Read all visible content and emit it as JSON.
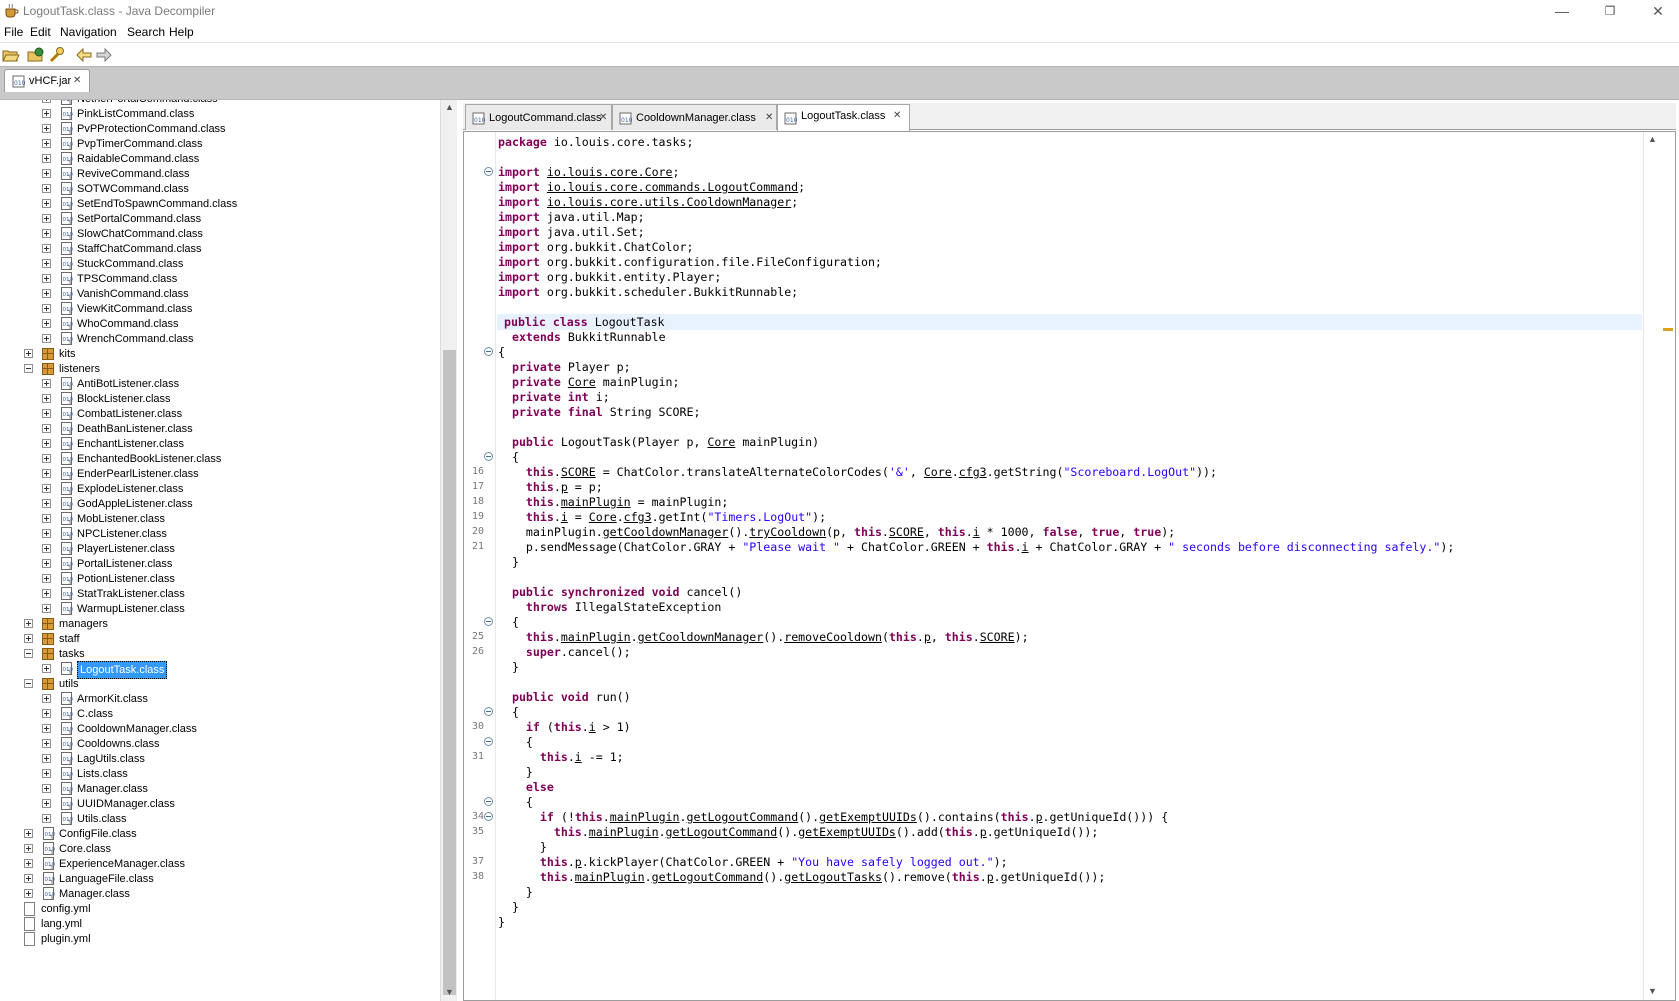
{
  "window": {
    "title": "LogoutTask.class - Java Decompiler",
    "minimize": "—",
    "restore": "❐",
    "close": "✕"
  },
  "menu": [
    "File",
    "Edit",
    "Navigation",
    "Search",
    "Help"
  ],
  "jar_tab": {
    "label": "vHCF.jar",
    "close": "✕"
  },
  "tree": [
    {
      "label": "NetherPortalCommand.class",
      "indent": 2,
      "kind": "class",
      "exp": "plus"
    },
    {
      "label": "PinkListCommand.class",
      "indent": 2,
      "kind": "class",
      "exp": "plus"
    },
    {
      "label": "PvPProtectionCommand.class",
      "indent": 2,
      "kind": "class",
      "exp": "plus"
    },
    {
      "label": "PvpTimerCommand.class",
      "indent": 2,
      "kind": "class",
      "exp": "plus"
    },
    {
      "label": "RaidableCommand.class",
      "indent": 2,
      "kind": "class",
      "exp": "plus"
    },
    {
      "label": "ReviveCommand.class",
      "indent": 2,
      "kind": "class",
      "exp": "plus"
    },
    {
      "label": "SOTWCommand.class",
      "indent": 2,
      "kind": "class",
      "exp": "plus"
    },
    {
      "label": "SetEndToSpawnCommand.class",
      "indent": 2,
      "kind": "class",
      "exp": "plus"
    },
    {
      "label": "SetPortalCommand.class",
      "indent": 2,
      "kind": "class",
      "exp": "plus"
    },
    {
      "label": "SlowChatCommand.class",
      "indent": 2,
      "kind": "class",
      "exp": "plus"
    },
    {
      "label": "StaffChatCommand.class",
      "indent": 2,
      "kind": "class",
      "exp": "plus"
    },
    {
      "label": "StuckCommand.class",
      "indent": 2,
      "kind": "class",
      "exp": "plus"
    },
    {
      "label": "TPSCommand.class",
      "indent": 2,
      "kind": "class",
      "exp": "plus"
    },
    {
      "label": "VanishCommand.class",
      "indent": 2,
      "kind": "class",
      "exp": "plus"
    },
    {
      "label": "ViewKitCommand.class",
      "indent": 2,
      "kind": "class",
      "exp": "plus"
    },
    {
      "label": "WhoCommand.class",
      "indent": 2,
      "kind": "class",
      "exp": "plus"
    },
    {
      "label": "WrenchCommand.class",
      "indent": 2,
      "kind": "class",
      "exp": "plus"
    },
    {
      "label": "kits",
      "indent": 1,
      "kind": "package",
      "exp": "plus"
    },
    {
      "label": "listeners",
      "indent": 1,
      "kind": "package",
      "exp": "minus"
    },
    {
      "label": "AntiBotListener.class",
      "indent": 2,
      "kind": "class",
      "exp": "plus"
    },
    {
      "label": "BlockListener.class",
      "indent": 2,
      "kind": "class",
      "exp": "plus"
    },
    {
      "label": "CombatListener.class",
      "indent": 2,
      "kind": "class",
      "exp": "plus"
    },
    {
      "label": "DeathBanListener.class",
      "indent": 2,
      "kind": "class",
      "exp": "plus"
    },
    {
      "label": "EnchantListener.class",
      "indent": 2,
      "kind": "class",
      "exp": "plus"
    },
    {
      "label": "EnchantedBookListener.class",
      "indent": 2,
      "kind": "class",
      "exp": "plus"
    },
    {
      "label": "EnderPearlListener.class",
      "indent": 2,
      "kind": "class",
      "exp": "plus"
    },
    {
      "label": "ExplodeListener.class",
      "indent": 2,
      "kind": "class",
      "exp": "plus"
    },
    {
      "label": "GodAppleListener.class",
      "indent": 2,
      "kind": "class",
      "exp": "plus"
    },
    {
      "label": "MobListener.class",
      "indent": 2,
      "kind": "class",
      "exp": "plus"
    },
    {
      "label": "NPCListener.class",
      "indent": 2,
      "kind": "class",
      "exp": "plus"
    },
    {
      "label": "PlayerListener.class",
      "indent": 2,
      "kind": "class",
      "exp": "plus"
    },
    {
      "label": "PortalListener.class",
      "indent": 2,
      "kind": "class",
      "exp": "plus"
    },
    {
      "label": "PotionListener.class",
      "indent": 2,
      "kind": "class",
      "exp": "plus"
    },
    {
      "label": "StatTrakListener.class",
      "indent": 2,
      "kind": "class",
      "exp": "plus"
    },
    {
      "label": "WarmupListener.class",
      "indent": 2,
      "kind": "class",
      "exp": "plus"
    },
    {
      "label": "managers",
      "indent": 1,
      "kind": "package",
      "exp": "plus"
    },
    {
      "label": "staff",
      "indent": 1,
      "kind": "package",
      "exp": "plus"
    },
    {
      "label": "tasks",
      "indent": 1,
      "kind": "package",
      "exp": "minus"
    },
    {
      "label": "LogoutTask.class",
      "indent": 2,
      "kind": "class",
      "exp": "plus",
      "selected": true
    },
    {
      "label": "utils",
      "indent": 1,
      "kind": "package",
      "exp": "minus"
    },
    {
      "label": "ArmorKit.class",
      "indent": 2,
      "kind": "class",
      "exp": "plus"
    },
    {
      "label": "C.class",
      "indent": 2,
      "kind": "class",
      "exp": "plus"
    },
    {
      "label": "CooldownManager.class",
      "indent": 2,
      "kind": "class",
      "exp": "plus"
    },
    {
      "label": "Cooldowns.class",
      "indent": 2,
      "kind": "class",
      "exp": "plus"
    },
    {
      "label": "LagUtils.class",
      "indent": 2,
      "kind": "class",
      "exp": "plus"
    },
    {
      "label": "Lists.class",
      "indent": 2,
      "kind": "class",
      "exp": "plus"
    },
    {
      "label": "Manager.class",
      "indent": 2,
      "kind": "class",
      "exp": "plus"
    },
    {
      "label": "UUIDManager.class",
      "indent": 2,
      "kind": "class",
      "exp": "plus"
    },
    {
      "label": "Utils.class",
      "indent": 2,
      "kind": "class",
      "exp": "plus"
    },
    {
      "label": "ConfigFile.class",
      "indent": 1,
      "kind": "class",
      "exp": "plus"
    },
    {
      "label": "Core.class",
      "indent": 1,
      "kind": "class",
      "exp": "plus"
    },
    {
      "label": "ExperienceManager.class",
      "indent": 1,
      "kind": "class",
      "exp": "plus"
    },
    {
      "label": "LanguageFile.class",
      "indent": 1,
      "kind": "class",
      "exp": "plus"
    },
    {
      "label": "Manager.class",
      "indent": 1,
      "kind": "class",
      "exp": "plus"
    },
    {
      "label": "config.yml",
      "indent": 0,
      "kind": "file"
    },
    {
      "label": "lang.yml",
      "indent": 0,
      "kind": "file"
    },
    {
      "label": "plugin.yml",
      "indent": 0,
      "kind": "file"
    }
  ],
  "editor_tabs": [
    {
      "label": "LogoutCommand.class",
      "close": "✕",
      "active": false
    },
    {
      "label": "CooldownManager.class",
      "close": "✕",
      "active": false
    },
    {
      "label": "LogoutTask.class",
      "close": "✕",
      "active": true
    }
  ],
  "code": [
    {
      "line": "",
      "fold": false,
      "html": "<span class=\"kw\">package</span> io.louis.core.tasks;"
    },
    {
      "line": "",
      "fold": false,
      "html": ""
    },
    {
      "line": "",
      "fold": true,
      "html": "<span class=\"kw\">import</span> <span class=\"u\">io.louis.core.Core</span>;"
    },
    {
      "line": "",
      "fold": false,
      "html": "<span class=\"kw\">import</span> <span class=\"u\">io.louis.core.commands.LogoutCommand</span>;"
    },
    {
      "line": "",
      "fold": false,
      "html": "<span class=\"kw\">import</span> <span class=\"u\">io.louis.core.utils.CooldownManager</span>;"
    },
    {
      "line": "",
      "fold": false,
      "html": "<span class=\"kw\">import</span> java.util.Map;"
    },
    {
      "line": "",
      "fold": false,
      "html": "<span class=\"kw\">import</span> java.util.Set;"
    },
    {
      "line": "",
      "fold": false,
      "html": "<span class=\"kw\">import</span> org.bukkit.ChatColor;"
    },
    {
      "line": "",
      "fold": false,
      "html": "<span class=\"kw\">import</span> org.bukkit.configuration.file.FileConfiguration;"
    },
    {
      "line": "",
      "fold": false,
      "html": "<span class=\"kw\">import</span> org.bukkit.entity.Player;"
    },
    {
      "line": "",
      "fold": false,
      "html": "<span class=\"kw\">import</span> org.bukkit.scheduler.BukkitRunnable;"
    },
    {
      "line": "",
      "fold": false,
      "html": ""
    },
    {
      "line": "",
      "fold": false,
      "hl": true,
      "html": "<span class=\"kw\">public class</span> LogoutTask"
    },
    {
      "line": "",
      "fold": false,
      "html": "  <span class=\"kw\">extends</span> BukkitRunnable"
    },
    {
      "line": "",
      "fold": true,
      "html": "{"
    },
    {
      "line": "",
      "fold": false,
      "html": "  <span class=\"kw\">private</span> Player p;"
    },
    {
      "line": "",
      "fold": false,
      "html": "  <span class=\"kw\">private</span> <span class=\"u\">Core</span> mainPlugin;"
    },
    {
      "line": "",
      "fold": false,
      "html": "  <span class=\"kw\">private int</span> i;"
    },
    {
      "line": "",
      "fold": false,
      "html": "  <span class=\"kw\">private final</span> String SCORE;"
    },
    {
      "line": "",
      "fold": false,
      "html": ""
    },
    {
      "line": "",
      "fold": false,
      "html": "  <span class=\"kw\">public</span> LogoutTask(Player p, <span class=\"u\">Core</span> mainPlugin)"
    },
    {
      "line": "",
      "fold": true,
      "html": "  {"
    },
    {
      "line": "16",
      "fold": false,
      "html": "    <span class=\"kw\">this</span>.<span class=\"u\">SCORE</span> = ChatColor.translateAlternateColorCodes(<span class=\"str\">'&amp;'</span>, <span class=\"u\">Core</span>.<span class=\"u\">cfg3</span>.getString(<span class=\"str\">\"Scoreboard.LogOut\"</span>));"
    },
    {
      "line": "17",
      "fold": false,
      "html": "    <span class=\"kw\">this</span>.<span class=\"u\">p</span> = p;"
    },
    {
      "line": "18",
      "fold": false,
      "html": "    <span class=\"kw\">this</span>.<span class=\"u\">mainPlugin</span> = mainPlugin;"
    },
    {
      "line": "19",
      "fold": false,
      "html": "    <span class=\"kw\">this</span>.<span class=\"u\">i</span> = <span class=\"u\">Core</span>.<span class=\"u\">cfg3</span>.getInt(<span class=\"str\">\"Timers.LogOut\"</span>);"
    },
    {
      "line": "20",
      "fold": false,
      "html": "    mainPlugin.<span class=\"u\">getCooldownManager</span>().<span class=\"u\">tryCooldown</span>(p, <span class=\"kw\">this</span>.<span class=\"u\">SCORE</span>, <span class=\"kw\">this</span>.<span class=\"u\">i</span> * 1000, <span class=\"kw\">false</span>, <span class=\"kw\">true</span>, <span class=\"kw\">true</span>);"
    },
    {
      "line": "21",
      "fold": false,
      "html": "    p.sendMessage(ChatColor.GRAY + <span class=\"str\">\"Please wait \"</span> + ChatColor.GREEN + <span class=\"kw\">this</span>.<span class=\"u\">i</span> + ChatColor.GRAY + <span class=\"str\">\" seconds before disconnecting safely.\"</span>);"
    },
    {
      "line": "",
      "fold": false,
      "html": "  }"
    },
    {
      "line": "",
      "fold": false,
      "html": ""
    },
    {
      "line": "",
      "fold": false,
      "html": "  <span class=\"kw\">public synchronized void</span> cancel()"
    },
    {
      "line": "",
      "fold": false,
      "html": "    <span class=\"kw\">throws</span> IllegalStateException"
    },
    {
      "line": "",
      "fold": true,
      "html": "  {"
    },
    {
      "line": "25",
      "fold": false,
      "html": "    <span class=\"kw\">this</span>.<span class=\"u\">mainPlugin</span>.<span class=\"u\">getCooldownManager</span>().<span class=\"u\">removeCooldown</span>(<span class=\"kw\">this</span>.<span class=\"u\">p</span>, <span class=\"kw\">this</span>.<span class=\"u\">SCORE</span>);"
    },
    {
      "line": "26",
      "fold": false,
      "html": "    <span class=\"kw\">super</span>.cancel();"
    },
    {
      "line": "",
      "fold": false,
      "html": "  }"
    },
    {
      "line": "",
      "fold": false,
      "html": ""
    },
    {
      "line": "",
      "fold": false,
      "html": "  <span class=\"kw\">public void</span> run()"
    },
    {
      "line": "",
      "fold": true,
      "html": "  {"
    },
    {
      "line": "30",
      "fold": false,
      "html": "    <span class=\"kw\">if</span> (<span class=\"kw\">this</span>.<span class=\"u\">i</span> &gt; 1)"
    },
    {
      "line": "",
      "fold": true,
      "html": "    {"
    },
    {
      "line": "31",
      "fold": false,
      "html": "      <span class=\"kw\">this</span>.<span class=\"u\">i</span> -= 1;"
    },
    {
      "line": "",
      "fold": false,
      "html": "    }"
    },
    {
      "line": "",
      "fold": false,
      "html": "    <span class=\"kw\">else</span>"
    },
    {
      "line": "",
      "fold": true,
      "html": "    {"
    },
    {
      "line": "34",
      "fold": true,
      "html": "      <span class=\"kw\">if</span> (!<span class=\"kw\">this</span>.<span class=\"u\">mainPlugin</span>.<span class=\"u\">getLogoutCommand</span>().<span class=\"u\">getExemptUUIDs</span>().contains(<span class=\"kw\">this</span>.<span class=\"u\">p</span>.getUniqueId())) {"
    },
    {
      "line": "35",
      "fold": false,
      "html": "        <span class=\"kw\">this</span>.<span class=\"u\">mainPlugin</span>.<span class=\"u\">getLogoutCommand</span>().<span class=\"u\">getExemptUUIDs</span>().add(<span class=\"kw\">this</span>.<span class=\"u\">p</span>.getUniqueId());"
    },
    {
      "line": "",
      "fold": false,
      "html": "      }"
    },
    {
      "line": "37",
      "fold": false,
      "html": "      <span class=\"kw\">this</span>.<span class=\"u\">p</span>.kickPlayer(ChatColor.GREEN + <span class=\"str\">\"You have safely logged out.\"</span>);"
    },
    {
      "line": "38",
      "fold": false,
      "html": "      <span class=\"kw\">this</span>.<span class=\"u\">mainPlugin</span>.<span class=\"u\">getLogoutCommand</span>().<span class=\"u\">getLogoutTasks</span>().remove(<span class=\"kw\">this</span>.<span class=\"u\">p</span>.getUniqueId());"
    },
    {
      "line": "",
      "fold": false,
      "html": "    }"
    },
    {
      "line": "",
      "fold": false,
      "html": "  }"
    },
    {
      "line": "",
      "fold": false,
      "html": "}"
    }
  ]
}
